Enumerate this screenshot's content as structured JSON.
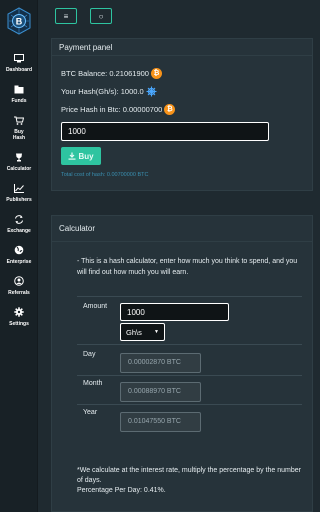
{
  "sidebar": {
    "items": [
      {
        "label": "Dashboard",
        "icon": "monitor-icon"
      },
      {
        "label": "Funds",
        "icon": "folder-icon"
      },
      {
        "label": "Buy\nHash",
        "icon": "cart-icon"
      },
      {
        "label": "Calculator",
        "icon": "trophy-icon"
      },
      {
        "label": "Publishers",
        "icon": "chart-icon"
      },
      {
        "label": "Exchange",
        "icon": "exchange-icon"
      },
      {
        "label": "Enterprise",
        "icon": "globe-icon"
      },
      {
        "label": "Referrals",
        "icon": "user-icon"
      },
      {
        "label": "Settings",
        "icon": "gear-icon"
      }
    ]
  },
  "topbar": {
    "menu_glyph": "≡",
    "circle_glyph": "○"
  },
  "payment": {
    "title": "Payment panel",
    "balance": "BTC Balance: 0.21061900",
    "hash": "Your Hash(Gh/s): 1000.0",
    "price": "Price Hash in Btc: 0.00000700",
    "amount_value": "1000",
    "buy_label": "Buy",
    "total": "Total cost of hash: 0.00700000 BTC"
  },
  "calculator": {
    "title": "Calculator",
    "description": "- This is a hash calculator, enter how much you think to spend, and you will find out how much you will earn.",
    "amount_label": "Amount",
    "amount_value": "1000",
    "unit": "Gh\\s",
    "day_label": "Day",
    "day_value": "0.00002870 BTC",
    "month_label": "Month",
    "month_value": "0.00088970 BTC",
    "year_label": "Year",
    "year_value": "0.01047550 BTC",
    "note": "*We calculate at the interest rate, multiply the percentage by the number of days.",
    "percentage": "Percentage Per Day: 0.41%."
  },
  "colors": {
    "accent": "#2ec4a0",
    "bitcoin": "#f7931a",
    "link": "#3a8fb0"
  }
}
